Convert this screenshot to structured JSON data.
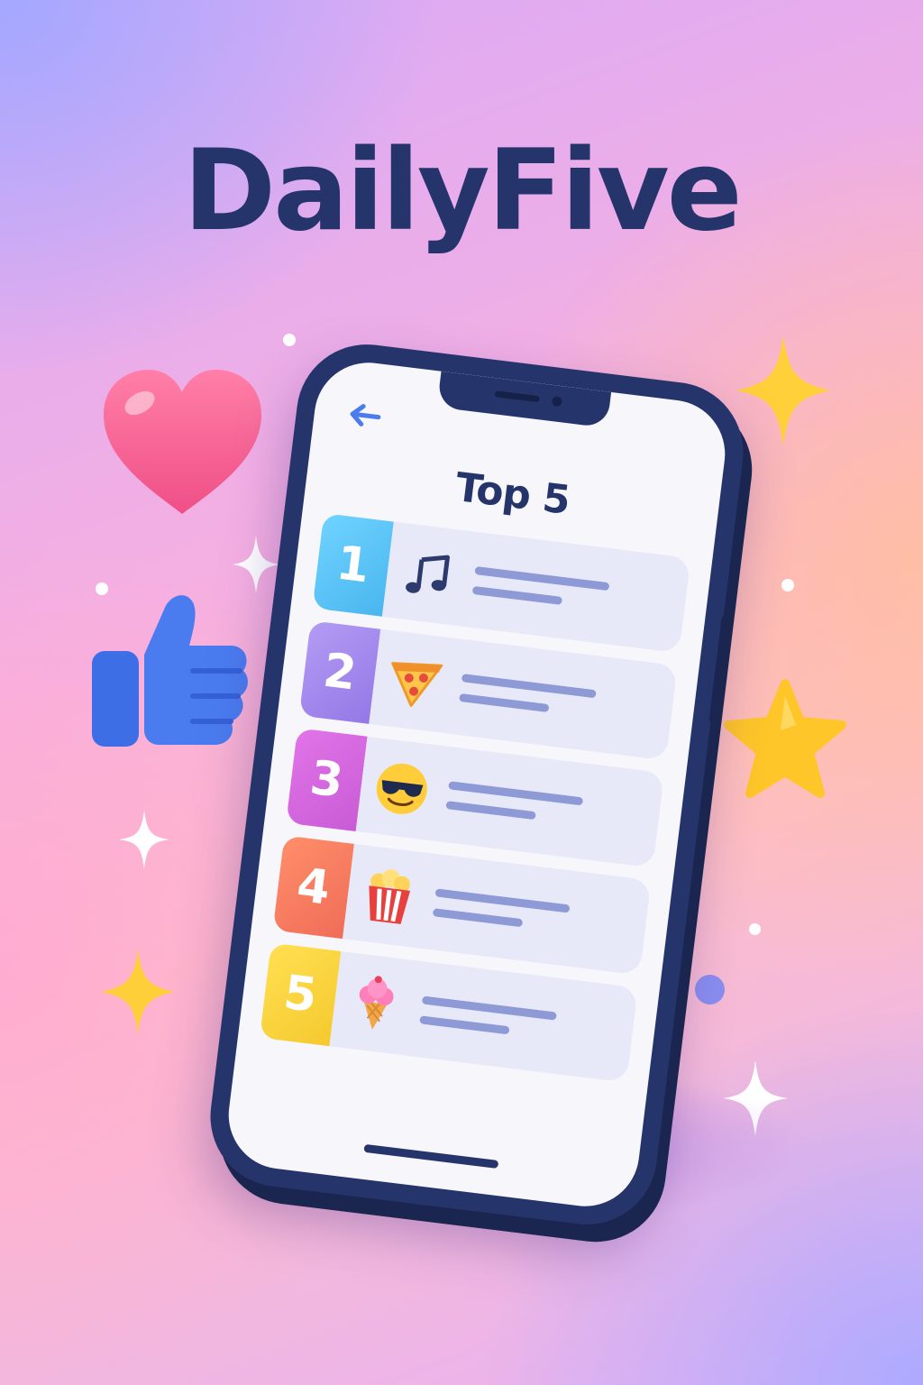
{
  "app": {
    "title": "DailyFive"
  },
  "screen": {
    "back_icon": "arrow-left-icon",
    "title": "Top 5"
  },
  "items": [
    {
      "rank": "1",
      "icon": "music-note-icon",
      "color": "#55c4f6"
    },
    {
      "rank": "2",
      "icon": "pizza-icon",
      "color": "#a487ee"
    },
    {
      "rank": "3",
      "icon": "sunglasses-emoji-icon",
      "color": "#d767df"
    },
    {
      "rank": "4",
      "icon": "popcorn-icon",
      "color": "#f57c62"
    },
    {
      "rank": "5",
      "icon": "ice-cream-icon",
      "color": "#f7d23d"
    }
  ],
  "decorations": [
    "heart-icon",
    "thumbs-up-icon",
    "star-icon",
    "sparkle-icon"
  ],
  "colors": {
    "brand_navy": "#25356b",
    "card_bg": "#e7e9f8",
    "line": "#8e9ad6"
  }
}
